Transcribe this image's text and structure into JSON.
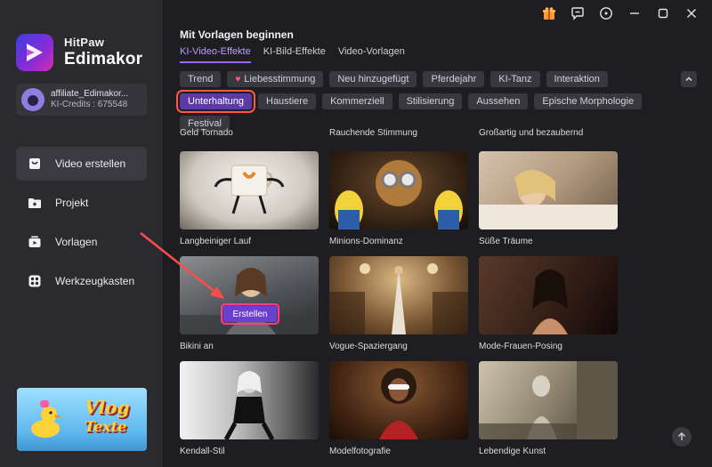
{
  "app": {
    "brand_line1": "HitPaw",
    "brand_line2": "Edimakor"
  },
  "user": {
    "name": "affiliate_Edimakor...",
    "credits": "KI-Credits : 675548"
  },
  "nav": [
    {
      "label": "Video erstellen",
      "icon": "video-create-icon",
      "active": true
    },
    {
      "label": "Projekt",
      "icon": "folder-icon",
      "active": false
    },
    {
      "label": "Vorlagen",
      "icon": "template-icon",
      "active": false
    },
    {
      "label": "Werkzeugkasten",
      "icon": "toolbox-icon",
      "active": false
    }
  ],
  "promo": {
    "line1": "Vlog",
    "line2": "Texte"
  },
  "main": {
    "title": "Mit Vorlagen beginnen",
    "tabs": [
      {
        "label": "KI-Video-Effekte",
        "active": true
      },
      {
        "label": "KI-Bild-Effekte",
        "active": false
      },
      {
        "label": "Video-Vorlagen",
        "active": false
      }
    ],
    "chips": [
      "Trend",
      "Liebesstimmung",
      "Neu hinzugefügt",
      "Pferdejahr",
      "KI-Tanz",
      "Interaktion",
      "Unterhaltung",
      "Haustiere",
      "Kommerziell",
      "Stilisierung",
      "Aussehen",
      "Epische Morphologie",
      "Festival"
    ],
    "selected_chip": "Unterhaltung",
    "top_captions": [
      "Geld Tornado",
      "Rauchende Stimmung",
      "Großartig und bezaubernd"
    ],
    "cards": [
      {
        "caption": "Langbeiniger Lauf"
      },
      {
        "caption": "Minions-Dominanz"
      },
      {
        "caption": "Süße Träume"
      },
      {
        "caption": "Bikini an"
      },
      {
        "caption": "Vogue-Spaziergang"
      },
      {
        "caption": "Mode-Frauen-Posing"
      },
      {
        "caption": "Kendall-Stil"
      },
      {
        "caption": "Modelfotografie"
      },
      {
        "caption": "Lebendige Kunst"
      }
    ],
    "create_label": "Erstellen"
  },
  "colors": {
    "accent": "#9b6bff",
    "selected_chip_bg": "#5b3aa6",
    "highlight_border": "#ff5a3c",
    "background": "#1e1e22",
    "sidebar": "#2a2a2f"
  }
}
